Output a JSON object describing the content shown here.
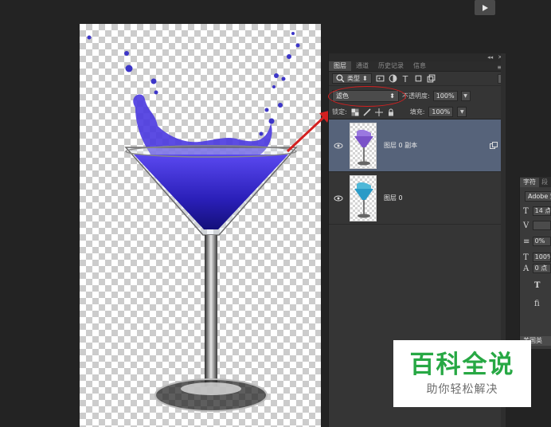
{
  "window": {
    "play_icon": "play-icon"
  },
  "layers_panel": {
    "topbar": {
      "collapse": "◂◂",
      "close": "✕"
    },
    "tabs": [
      {
        "label": "图层",
        "active": true
      },
      {
        "label": "通道",
        "active": false
      },
      {
        "label": "历史记录",
        "active": false
      },
      {
        "label": "信息",
        "active": false
      }
    ],
    "menu_icon": "≡",
    "filter": {
      "kind_label": "类型"
    },
    "blend_mode": {
      "value": "滤色"
    },
    "opacity": {
      "label": "不透明度:",
      "value": "100%"
    },
    "lock": {
      "label": "锁定:"
    },
    "fill": {
      "label": "填充:",
      "value": "100%"
    },
    "layers": [
      {
        "name": "图层 0 副本",
        "selected": true,
        "tint": "#7a52c8"
      },
      {
        "name": "图层 0",
        "selected": false,
        "tint": "#2b9bc7"
      }
    ]
  },
  "character_panel": {
    "tab1": "字符",
    "tab2": "段",
    "font": "Adobe 宋",
    "size": "14 点",
    "tracking": "0%",
    "scale": "100%",
    "baseline": "0 点",
    "bold_glyph": "T",
    "ligature_glyph": "fi",
    "language": "美国英"
  },
  "watermark": {
    "title": "百科全说",
    "subtitle": "助你轻松解决"
  },
  "colors": {
    "highlight": "#d32020",
    "selected_layer": "#56637a",
    "liquid": "#3a2bd6",
    "watermark_green": "#27a844"
  }
}
